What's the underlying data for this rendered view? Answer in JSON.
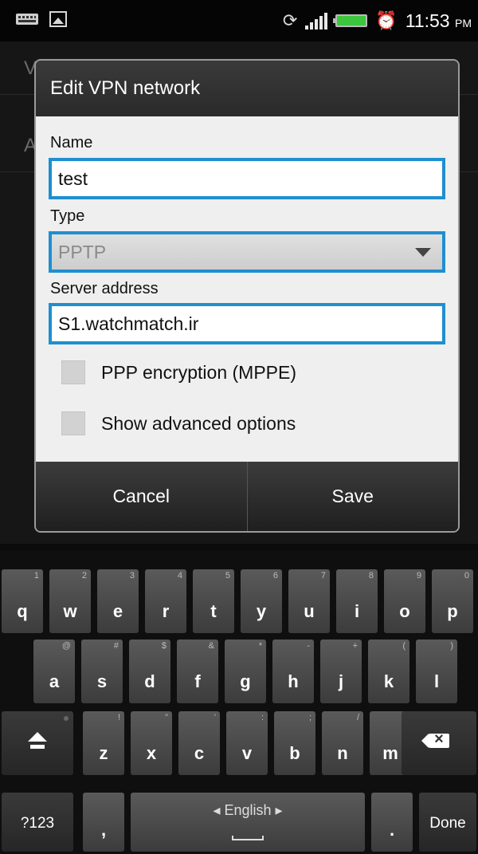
{
  "status_bar": {
    "time": "11:53",
    "ampm": "PM",
    "icons": [
      "keyboard-notification-icon",
      "image-notification-icon",
      "rotate-icon",
      "signal-icon",
      "battery-icon",
      "alarm-icon"
    ]
  },
  "background_screen": {
    "rows": [
      "V",
      "A"
    ]
  },
  "dialog": {
    "title": "Edit VPN network",
    "fields": {
      "name_label": "Name",
      "name_value": "test",
      "type_label": "Type",
      "type_value": "PPTP",
      "server_label": "Server address",
      "server_value": "S1.watchmatch.ir"
    },
    "checkboxes": {
      "ppp_encryption": {
        "label": "PPP encryption (MPPE)",
        "checked": false
      },
      "show_advanced": {
        "label": "Show advanced options",
        "checked": false
      }
    },
    "buttons": {
      "cancel": "Cancel",
      "save": "Save"
    }
  },
  "keyboard": {
    "row1": [
      {
        "k": "q",
        "h": "1"
      },
      {
        "k": "w",
        "h": "2"
      },
      {
        "k": "e",
        "h": "3"
      },
      {
        "k": "r",
        "h": "4"
      },
      {
        "k": "t",
        "h": "5"
      },
      {
        "k": "y",
        "h": "6"
      },
      {
        "k": "u",
        "h": "7"
      },
      {
        "k": "i",
        "h": "8"
      },
      {
        "k": "o",
        "h": "9"
      },
      {
        "k": "p",
        "h": "0"
      }
    ],
    "row2": [
      {
        "k": "a",
        "h": "@"
      },
      {
        "k": "s",
        "h": "#"
      },
      {
        "k": "d",
        "h": "$"
      },
      {
        "k": "f",
        "h": "&"
      },
      {
        "k": "g",
        "h": "*"
      },
      {
        "k": "h",
        "h": "-"
      },
      {
        "k": "j",
        "h": "+"
      },
      {
        "k": "k",
        "h": "("
      },
      {
        "k": "l",
        "h": ")"
      }
    ],
    "row3": [
      {
        "k": "z",
        "h": "!"
      },
      {
        "k": "x",
        "h": "\""
      },
      {
        "k": "c",
        "h": "'"
      },
      {
        "k": "v",
        "h": ":"
      },
      {
        "k": "b",
        "h": ";"
      },
      {
        "k": "n",
        "h": "/"
      },
      {
        "k": "m",
        "h": "?"
      }
    ],
    "mode_key": "?123",
    "comma_key": ",",
    "period_key": ".",
    "language": "◂ English ▸",
    "done_key": "Done"
  }
}
